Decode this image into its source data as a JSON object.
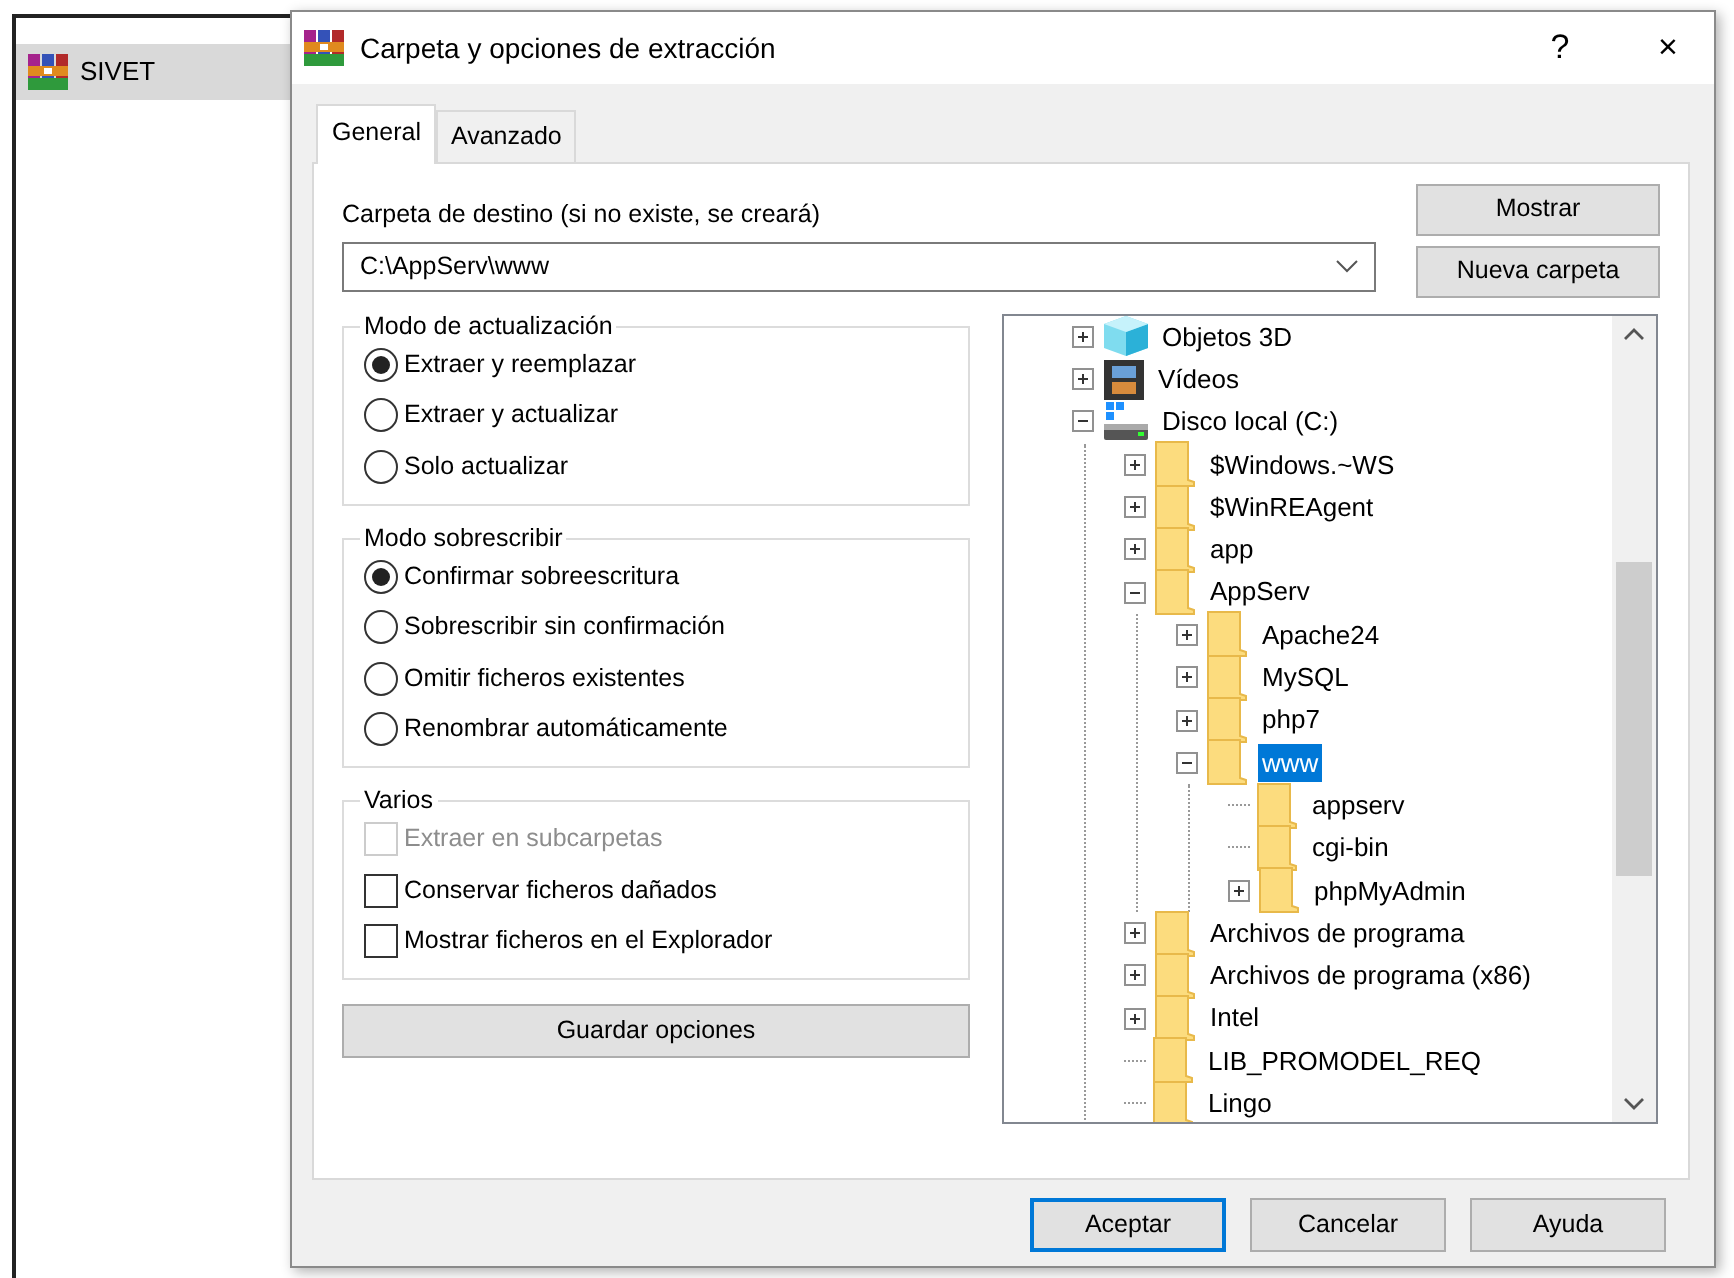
{
  "app_window": {
    "list_items": [
      {
        "label": "SIVET",
        "selected": true
      }
    ]
  },
  "dialog": {
    "title": "Carpeta y opciones de extracción",
    "help_button": "?",
    "close_button": "×",
    "tabs": [
      {
        "label": "General",
        "selected": true
      },
      {
        "label": "Avanzado",
        "selected": false
      }
    ],
    "destination": {
      "label": "Carpeta de destino (si no existe, se creará)",
      "value": "C:\\AppServ\\www"
    },
    "side_buttons": [
      "Mostrar",
      "Nueva carpeta"
    ],
    "groups": [
      {
        "title": "Modo de actualización",
        "kind": "radio",
        "options": [
          {
            "label": "Extraer y reemplazar",
            "selected": true
          },
          {
            "label": "Extraer y actualizar",
            "selected": false
          },
          {
            "label": "Solo actualizar",
            "selected": false
          }
        ]
      },
      {
        "title": "Modo sobrescribir",
        "kind": "radio",
        "options": [
          {
            "label": "Confirmar sobreescritura",
            "selected": true
          },
          {
            "label": "Sobrescribir sin confirmación",
            "selected": false
          },
          {
            "label": "Omitir ficheros existentes",
            "selected": false
          },
          {
            "label": "Renombrar automáticamente",
            "selected": false
          }
        ]
      },
      {
        "title": "Varios",
        "kind": "checkbox",
        "options": [
          {
            "label": "Extraer en subcarpetas",
            "checked": false,
            "disabled": true
          },
          {
            "label": "Conservar ficheros dañados",
            "checked": false,
            "disabled": false
          },
          {
            "label": "Mostrar ficheros en el Explorador",
            "checked": false,
            "disabled": false
          }
        ]
      }
    ],
    "save_button": "Guardar opciones",
    "tree": [
      {
        "label": "Objetos 3D",
        "kind": "cube",
        "expanded": false,
        "selected": false
      },
      {
        "label": "Vídeos",
        "kind": "film",
        "expanded": false,
        "selected": false
      },
      {
        "label": "Disco local (C:)",
        "kind": "drive",
        "expanded": true,
        "selected": false,
        "children": [
          {
            "label": "$Windows.~WS",
            "kind": "folder",
            "expanded": false,
            "selected": false
          },
          {
            "label": "$WinREAgent",
            "kind": "folder",
            "expanded": false,
            "selected": false
          },
          {
            "label": "app",
            "kind": "folder",
            "expanded": false,
            "selected": false
          },
          {
            "label": "AppServ",
            "kind": "folder",
            "expanded": true,
            "selected": false,
            "children": [
              {
                "label": "Apache24",
                "kind": "folder",
                "expanded": false,
                "selected": false
              },
              {
                "label": "MySQL",
                "kind": "folder",
                "expanded": false,
                "selected": false
              },
              {
                "label": "php7",
                "kind": "folder",
                "expanded": false,
                "selected": false
              },
              {
                "label": "www",
                "kind": "folder",
                "expanded": true,
                "selected": true,
                "children": [
                  {
                    "label": "appserv",
                    "kind": "folder",
                    "selected": false
                  },
                  {
                    "label": "cgi-bin",
                    "kind": "folder",
                    "selected": false
                  },
                  {
                    "label": "phpMyAdmin",
                    "kind": "folder",
                    "expanded": false,
                    "selected": false
                  }
                ]
              }
            ]
          },
          {
            "label": "Archivos de programa",
            "kind": "folder",
            "expanded": false,
            "selected": false
          },
          {
            "label": "Archivos de programa (x86)",
            "kind": "folder",
            "expanded": false,
            "selected": false
          },
          {
            "label": "Intel",
            "kind": "folder",
            "expanded": false,
            "selected": false
          },
          {
            "label": "LIB_PROMODEL_REQ",
            "kind": "folder",
            "selected": false
          },
          {
            "label": "Lingo",
            "kind": "folder",
            "selected": false
          }
        ]
      }
    ],
    "buttons": [
      {
        "label": "Aceptar",
        "default": true
      },
      {
        "label": "Cancelar",
        "default": false
      },
      {
        "label": "Ayuda",
        "default": false
      }
    ]
  }
}
